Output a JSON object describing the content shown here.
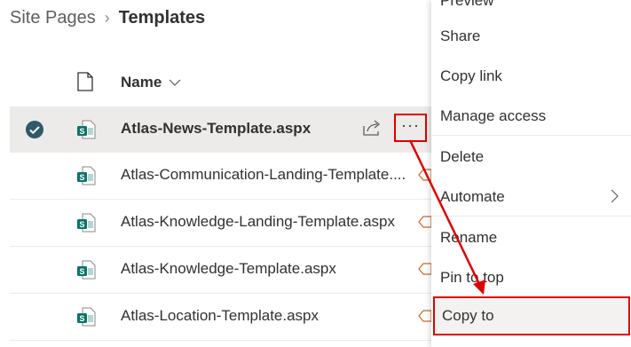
{
  "breadcrumb": {
    "root": "Site Pages",
    "separator": "›",
    "current": "Templates"
  },
  "list": {
    "column_name": "Name",
    "rows": [
      {
        "name": "Atlas-News-Template.aspx",
        "selected": true
      },
      {
        "name": "Atlas-Communication-Landing-Template....",
        "selected": false
      },
      {
        "name": "Atlas-Knowledge-Landing-Template.aspx",
        "selected": false
      },
      {
        "name": "Atlas-Knowledge-Template.aspx",
        "selected": false
      },
      {
        "name": "Atlas-Location-Template.aspx",
        "selected": false
      }
    ],
    "more_label": "···"
  },
  "menu": {
    "items": [
      {
        "label": "Preview"
      },
      {
        "label": "Share"
      },
      {
        "label": "Copy link"
      },
      {
        "label": "Manage access"
      },
      {
        "label": "Delete"
      },
      {
        "label": "Automate"
      },
      {
        "label": "Rename"
      },
      {
        "label": "Pin to top"
      },
      {
        "label": "Copy to"
      }
    ]
  },
  "colors": {
    "accent_annotation": "#e00000",
    "selected_row": "#edebe9",
    "sharepoint_icon": "#077568",
    "check": "#30596a"
  }
}
